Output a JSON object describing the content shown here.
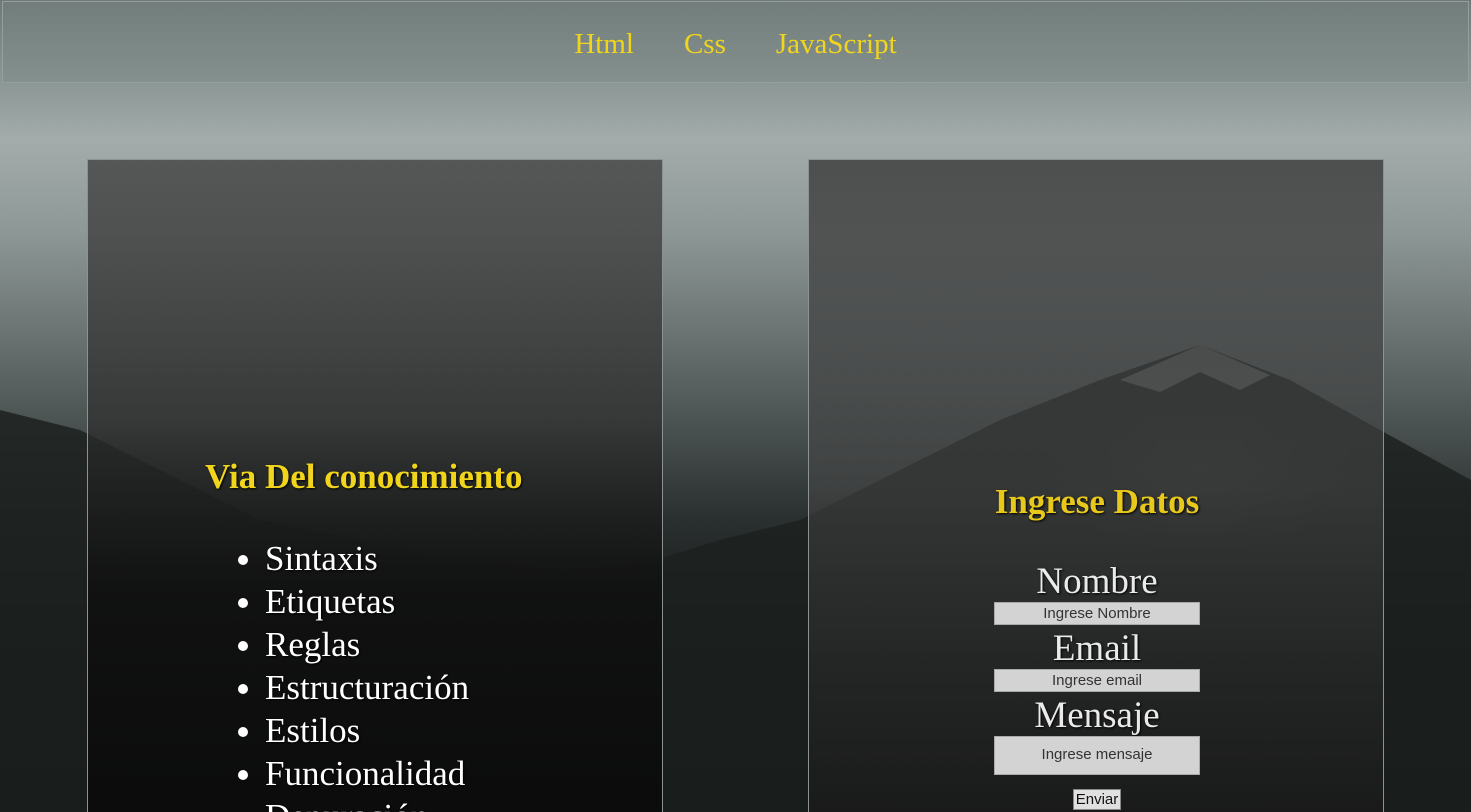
{
  "nav": {
    "items": [
      {
        "label": "Html"
      },
      {
        "label": "Css"
      },
      {
        "label": "JavaScript"
      }
    ]
  },
  "left_panel": {
    "title": "Via Del conocimiento",
    "topics": [
      "Sintaxis",
      "Etiquetas",
      "Reglas",
      "Estructuración",
      "Estilos",
      "Funcionalidad",
      "Depuración"
    ]
  },
  "form": {
    "title": "Ingrese Datos",
    "name_label": "Nombre",
    "name_placeholder": "Ingrese Nombre",
    "email_label": "Email",
    "email_placeholder": "Ingrese email",
    "message_label": "Mensaje",
    "message_placeholder": "Ingrese mensaje",
    "submit_label": "Enviar"
  },
  "colors": {
    "accent": "#f1d51d",
    "text": "#ffffff"
  }
}
